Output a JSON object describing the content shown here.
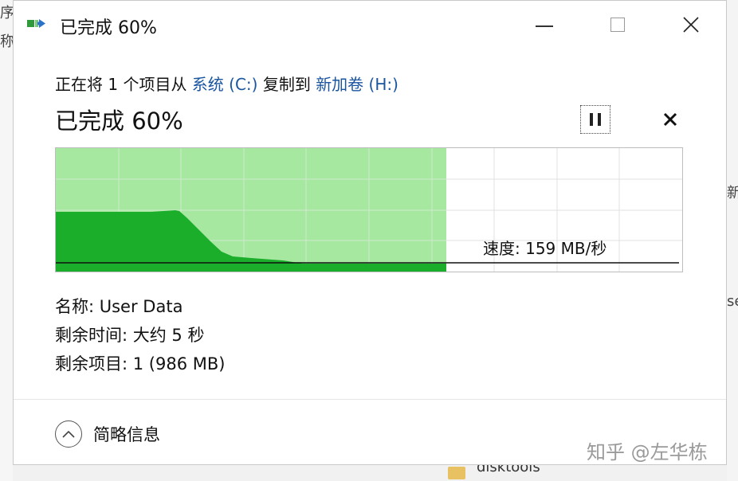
{
  "background": {
    "left_fragments": [
      "序",
      "称"
    ],
    "right_fragment_1": "新",
    "right_fragment_2": "se",
    "bottom_folder_label": "disktools"
  },
  "window": {
    "title": "已完成 60%",
    "title_icon": "copy-progress-icon",
    "controls": [
      "minimize-icon",
      "maximize-icon",
      "close-icon"
    ]
  },
  "copy": {
    "prefix": "正在将 1 个项目从 ",
    "source": "系统 (C:)",
    "middle": " 复制到 ",
    "destination": "新加卷 (H:)",
    "status": "已完成 60%",
    "progress_percent": 60,
    "pause_icon": "pause-icon",
    "cancel_icon": "cancel-x-icon"
  },
  "graph": {
    "speed_label": "速度: 159 MB/秒",
    "progress_fraction": 0.6,
    "colors": {
      "progress_fill": "#a6e8a0",
      "throughput_fill": "#1aae2a",
      "grid": "#cfe9cc",
      "grid_unfilled": "#e0e0e0",
      "speed_line": "#111111"
    }
  },
  "details": {
    "name": "名称: User Data",
    "time_left": "剩余时间: 大约 5 秒",
    "items_left": "剩余项目: 1 (986 MB)"
  },
  "footer": {
    "toggle_icon": "chevron-up-circle-icon",
    "toggle_label": "简略信息"
  },
  "watermark": "知乎 @左华栋"
}
